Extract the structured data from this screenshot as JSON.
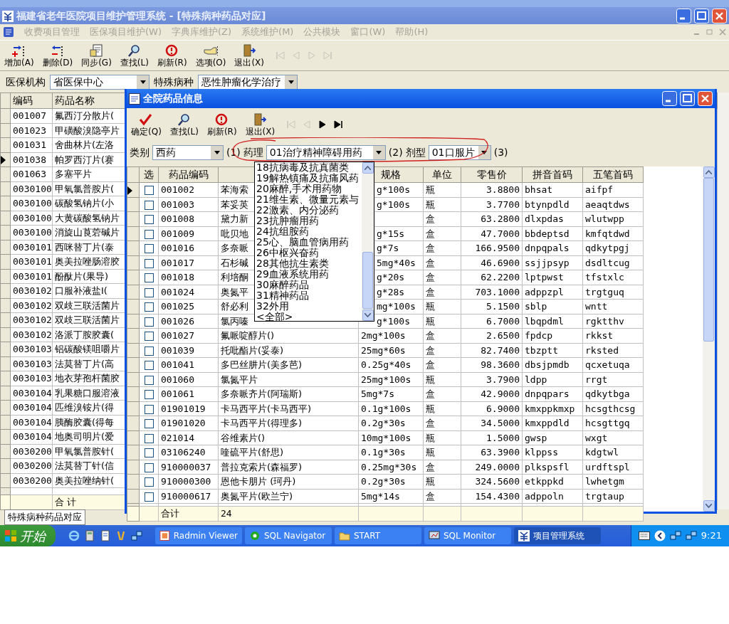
{
  "window": {
    "title": "福建省老年医院项目维护管理系统 - [特殊病种药品对应]"
  },
  "menu": [
    {
      "label": "收费项目管理"
    },
    {
      "label": "医保项目维护(W)"
    },
    {
      "label": "字典库维护(Z)"
    },
    {
      "label": "系统维护(M)"
    },
    {
      "label": "公共模块"
    },
    {
      "label": "窗口(W)"
    },
    {
      "label": "帮助(H)"
    }
  ],
  "toolbar": [
    {
      "label": "增加(A)",
      "kind": "add"
    },
    {
      "label": "删除(D)",
      "kind": "delete"
    },
    {
      "label": "同步(G)",
      "kind": "sync"
    },
    {
      "label": "查找(L)",
      "kind": "search"
    },
    {
      "label": "刷新(R)",
      "kind": "refresh"
    },
    {
      "label": "选项(O)",
      "kind": "options"
    },
    {
      "label": "退出(X)",
      "kind": "exit"
    }
  ],
  "nav": [
    {
      "kind": "first",
      "disabled": true
    },
    {
      "kind": "prev",
      "disabled": true
    },
    {
      "kind": "next",
      "disabled": true
    },
    {
      "kind": "last",
      "disabled": true
    }
  ],
  "filters": [
    {
      "label": "医保机构",
      "value": "省医保中心"
    },
    {
      "label": "特殊病种",
      "value": "恶性肿瘤化学治疗"
    }
  ],
  "main_table": {
    "columns": [
      "编码",
      "药品名称"
    ],
    "rows": [
      {
        "code": "001007",
        "name": "氟西汀分散片(",
        "current": false
      },
      {
        "code": "001023",
        "name": "甲磺酸溴隐亭片",
        "current": false
      },
      {
        "code": "001031",
        "name": "舍曲林片(左洛",
        "current": false
      },
      {
        "code": "001038",
        "name": "帕罗西汀片(赛",
        "current": true
      },
      {
        "code": "001063",
        "name": "多塞平片",
        "current": false
      },
      {
        "code": "0030100",
        "name": "甲氧氯普胺片(",
        "current": false
      },
      {
        "code": "0030100",
        "name": "碳酸氢钠片(小",
        "current": false
      },
      {
        "code": "0030100",
        "name": "大黄碳酸氢钠片",
        "current": false
      },
      {
        "code": "0030100",
        "name": "消旋山莨菪碱片",
        "current": false
      },
      {
        "code": "0030101",
        "name": "西咪替丁片(泰",
        "current": false
      },
      {
        "code": "0030101",
        "name": "奥美拉唑肠溶胶",
        "current": false
      },
      {
        "code": "0030101",
        "name": "酚酞片(果导)",
        "current": false
      },
      {
        "code": "0030102",
        "name": "口服补液盐I(",
        "current": false
      },
      {
        "code": "0030102",
        "name": "双歧三联活菌片",
        "current": false
      },
      {
        "code": "0030102",
        "name": "双歧三联活菌片",
        "current": false
      },
      {
        "code": "0030102",
        "name": "洛派丁胺胶囊(",
        "current": false
      },
      {
        "code": "0030103",
        "name": "铝碳酸镁咀嚼片",
        "current": false
      },
      {
        "code": "0030103",
        "name": "法莫替丁片(高",
        "current": false
      },
      {
        "code": "0030103",
        "name": "地衣芽孢杆菌胶",
        "current": false
      },
      {
        "code": "0030104",
        "name": "乳果糖口服溶液",
        "current": false
      },
      {
        "code": "0030104",
        "name": "匹维溴铵片(得",
        "current": false
      },
      {
        "code": "0030104",
        "name": "胰酶胶囊(得每",
        "current": false
      },
      {
        "code": "0030104",
        "name": "地奥司明片(爱",
        "current": false
      },
      {
        "code": "0030200",
        "name": "甲氧氯普胺针(",
        "current": false
      },
      {
        "code": "0030200",
        "name": "法莫替丁针(信",
        "current": false
      },
      {
        "code": "0030200",
        "name": "奥美拉唑纳针(",
        "current": false
      }
    ],
    "total_label": "合 计"
  },
  "document_tab": "特殊病种药品对应",
  "dialog": {
    "title": "全院药品信息",
    "toolbar": [
      {
        "label": "确定(Q)",
        "kind": "ok"
      },
      {
        "label": "查找(L)",
        "kind": "search"
      },
      {
        "label": "刷新(R)",
        "kind": "refresh"
      },
      {
        "label": "退出(X)",
        "kind": "exit"
      }
    ],
    "nav": [
      {
        "kind": "first",
        "disabled": true
      },
      {
        "kind": "prev",
        "disabled": true
      },
      {
        "kind": "next",
        "disabled": false
      },
      {
        "kind": "last",
        "disabled": false
      }
    ],
    "filters": [
      {
        "label": "类别",
        "value": "西药",
        "suffix": "(1)"
      },
      {
        "label": "药理",
        "value": "01治疗精神障碍用药",
        "suffix": "(2)"
      },
      {
        "label": "剂型",
        "value": "01口服片",
        "suffix": "(3)"
      }
    ],
    "dropdown": {
      "items": [
        "18抗病毒及抗真菌类",
        "19解热镇痛及抗痛风药",
        "20麻醉,手术用药物",
        "21维生素、微量元素与",
        "22激素、内分泌药",
        "23抗肿瘤用药",
        "24抗组胺药",
        "25心、脑血管病用药",
        "26中枢兴奋药",
        "28其他抗生素类",
        "29血液系统用药",
        "30麻醉药品",
        "31精神药品",
        "32外用",
        "<全部>"
      ]
    },
    "table": {
      "columns": [
        "选",
        "药品编码",
        "",
        "规格",
        "单位",
        "零售价",
        "拼音首码",
        "五笔首码"
      ],
      "rows": [
        {
          "checked": false,
          "current": true,
          "covered": true,
          "code": "001002",
          "name": "苯海索",
          "spec": "g*100s",
          "unit": "瓶",
          "price": "3.8800",
          "pinyin": "bhsat",
          "wubi": "aifpf"
        },
        {
          "checked": false,
          "current": false,
          "covered": true,
          "code": "001003",
          "name": "苯妥英",
          "spec": "g*100s",
          "unit": "瓶",
          "price": "3.7700",
          "pinyin": "btynpdld",
          "wubi": "aeaqtdws"
        },
        {
          "checked": false,
          "current": false,
          "code": "001008",
          "name": "黛力新",
          "unit": "盒",
          "price": "63.2800",
          "pinyin": "dlxpdas",
          "wubi": "wlutwpp"
        },
        {
          "checked": false,
          "current": false,
          "covered": true,
          "code": "001009",
          "name": "吡贝地",
          "spec": "g*15s",
          "unit": "盒",
          "price": "47.7000",
          "pinyin": "bbdeptsd",
          "wubi": "kmfqtdwd"
        },
        {
          "checked": false,
          "current": false,
          "covered": true,
          "code": "001016",
          "name": "多奈哌",
          "spec": "g*7s",
          "unit": "盒",
          "price": "166.9500",
          "pinyin": "dnpqpals",
          "wubi": "qdkytpgj"
        },
        {
          "checked": false,
          "current": false,
          "covered": true,
          "code": "001017",
          "name": "石杉碱",
          "spec": "5mg*40s",
          "unit": "盒",
          "price": "46.6900",
          "pinyin": "ssjjpsyp",
          "wubi": "dsdltcug"
        },
        {
          "checked": false,
          "current": false,
          "covered": true,
          "code": "001018",
          "name": "利培酮",
          "spec": "g*20s",
          "unit": "盒",
          "price": "62.2200",
          "pinyin": "lptpwst",
          "wubi": "tfstxlc"
        },
        {
          "checked": false,
          "current": false,
          "covered": true,
          "code": "001024",
          "name": "奥氮平",
          "spec": "g*28s",
          "unit": "盒",
          "price": "703.1000",
          "pinyin": "adppzpl",
          "wubi": "trgtguq"
        },
        {
          "checked": false,
          "current": false,
          "covered": true,
          "code": "001025",
          "name": "舒必利",
          "spec": "mg*100s",
          "unit": "瓶",
          "price": "5.1500",
          "pinyin": "sblp",
          "wubi": "wntt"
        },
        {
          "checked": false,
          "current": false,
          "covered": true,
          "code": "001026",
          "name": "氯丙嗪",
          "spec": "g*100s",
          "unit": "瓶",
          "price": "6.7000",
          "pinyin": "lbqpdml",
          "wubi": "rgktthv"
        },
        {
          "checked": false,
          "current": false,
          "covered": false,
          "code": "001027",
          "name": "氟哌啶醇片()",
          "spec": "2mg*100s",
          "unit": "盒",
          "price": "2.6500",
          "pinyin": "fpdcp",
          "wubi": "rkkst"
        },
        {
          "checked": false,
          "current": false,
          "covered": false,
          "code": "001039",
          "name": "托吡酯片(妥泰)",
          "spec": "25mg*60s",
          "unit": "盒",
          "price": "82.7400",
          "pinyin": "tbzptt",
          "wubi": "rksted"
        },
        {
          "checked": false,
          "current": false,
          "covered": false,
          "code": "001041",
          "name": "多巴丝肼片(美多芭)",
          "spec": "0.25g*40s",
          "unit": "盒",
          "price": "98.3600",
          "pinyin": "dbsjpmdb",
          "wubi": "qcxetuqa"
        },
        {
          "checked": false,
          "current": false,
          "covered": false,
          "code": "001060",
          "name": "氯氮平片",
          "spec": "25mg*100s",
          "unit": "瓶",
          "price": "3.7900",
          "pinyin": "ldpp",
          "wubi": "rrgt"
        },
        {
          "checked": false,
          "current": false,
          "covered": false,
          "code": "001061",
          "name": "多奈哌齐片(阿瑞斯)",
          "spec": "5mg*7s",
          "unit": "盒",
          "price": "42.9000",
          "pinyin": "dnpqpars",
          "wubi": "qdkytbga"
        },
        {
          "checked": false,
          "current": false,
          "covered": false,
          "code": "01901019",
          "name": "卡马西平片(卡马西平)",
          "spec": "0.1g*100s",
          "unit": "瓶",
          "price": "6.9000",
          "pinyin": "kmxppkmxp",
          "wubi": "hcsgthcsg"
        },
        {
          "checked": false,
          "current": false,
          "covered": false,
          "code": "01901020",
          "name": "卡马西平片(得理多)",
          "spec": "0.2g*30s",
          "unit": "盒",
          "price": "34.5000",
          "pinyin": "kmxppdld",
          "wubi": "hcsgttgq"
        },
        {
          "checked": false,
          "current": false,
          "covered": false,
          "code": "021014",
          "name": "谷维素片()",
          "spec": "10mg*100s",
          "unit": "瓶",
          "price": "1.5000",
          "pinyin": "gwsp",
          "wubi": "wxgt"
        },
        {
          "checked": false,
          "current": false,
          "covered": false,
          "code": "03106240",
          "name": "喹硫平片(舒思)",
          "spec": "0.1g*30s",
          "unit": "瓶",
          "price": "63.3900",
          "pinyin": "klppss",
          "wubi": "kdgtwl"
        },
        {
          "checked": false,
          "current": false,
          "covered": false,
          "code": "910000037",
          "name": "普拉克索片(森福罗)",
          "spec": "0.25mg*30s",
          "unit": "盒",
          "price": "249.0000",
          "pinyin": "plkspsfl",
          "wubi": "urdftspl"
        },
        {
          "checked": false,
          "current": false,
          "covered": false,
          "code": "910000300",
          "name": "恩他卡朋片 (珂丹)",
          "spec": "0.2g*30s",
          "unit": "瓶",
          "price": "324.5600",
          "pinyin": "etkppkd",
          "wubi": "lwhetgm"
        },
        {
          "checked": false,
          "current": false,
          "covered": false,
          "code": "910000617",
          "name": "奥氮平片(欧兰宁)",
          "spec": "5mg*14s",
          "unit": "盒",
          "price": "154.4300",
          "pinyin": "adppoln",
          "wubi": "trgtaup"
        }
      ],
      "total_label": "合计",
      "total_value": "24"
    }
  },
  "taskbar": {
    "start": "开始",
    "tasks": [
      {
        "label": "Radmin Viewer",
        "kind": "radmin",
        "selected": false
      },
      {
        "label": "SQL Navigator",
        "kind": "navigator",
        "selected": false
      },
      {
        "label": "START",
        "kind": "folder",
        "selected": false
      },
      {
        "label": "SQL Monitor",
        "kind": "monitor",
        "selected": false
      },
      {
        "label": "项目管理系统",
        "kind": "app",
        "selected": true
      }
    ],
    "clock": "9:21"
  }
}
